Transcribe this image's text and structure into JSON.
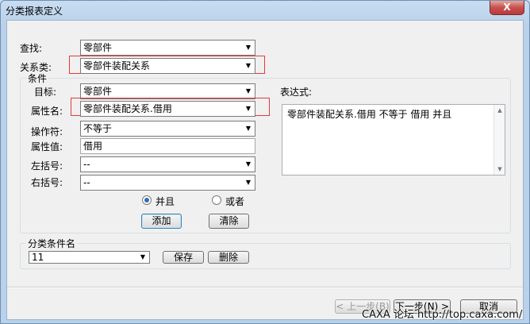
{
  "window": {
    "title": "分类报表定义",
    "close_glyph": "X"
  },
  "fields": {
    "find_label": "查找:",
    "find_value": "零部件",
    "relation_label": "关系类:",
    "relation_value": "零部件装配关系"
  },
  "condition": {
    "group_title": "条件",
    "target_label": "目标:",
    "target_value": "零部件",
    "attr_label": "属性名:",
    "attr_value": "零部件装配关系.借用",
    "op_label": "操作符:",
    "op_value": "不等于",
    "val_label": "属性值:",
    "val_value": "借用",
    "lbracket_label": "左括号:",
    "lbracket_value": "--",
    "rbracket_label": "右括号:",
    "rbracket_value": "--",
    "expr_label": "表达式:",
    "expr_value": "零部件装配关系.借用  不等于  借用    并且",
    "radio_and": "并且",
    "radio_or": "或者",
    "radio_and_selected": true,
    "add_button": "添加",
    "clear_button": "清除"
  },
  "category": {
    "group_title": "分类条件名",
    "name_value": "11",
    "save_button": "保存",
    "delete_button": "删除"
  },
  "footer": {
    "prev_button": "< 上一步(B)",
    "next_button": "下一步(N) >",
    "cancel_button": "取消"
  },
  "watermark": "CAXA 论坛 http://top.caxa.com/",
  "colors": {
    "highlight": "#e23b3b",
    "radio_dot": "#2f6fb8"
  }
}
